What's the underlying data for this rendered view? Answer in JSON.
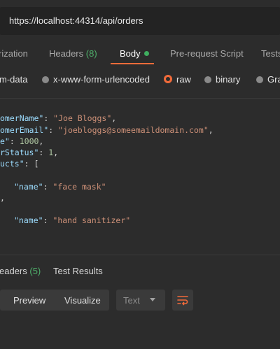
{
  "url": "https://localhost:44314/api/orders",
  "request_tabs": [
    {
      "label": "rization"
    },
    {
      "label": "Headers",
      "count": "(8)"
    },
    {
      "label": "Body"
    },
    {
      "label": "Pre-request Script"
    },
    {
      "label": "Tests"
    }
  ],
  "body_types": [
    {
      "label": "m-data",
      "selected": false
    },
    {
      "label": "x-www-form-urlencoded",
      "selected": false
    },
    {
      "label": "raw",
      "selected": true
    },
    {
      "label": "binary",
      "selected": false
    },
    {
      "label": "Gra",
      "selected": false
    }
  ],
  "editor": {
    "l1_key": "omerName\"",
    "l1_val": "\"Joe Bloggs\"",
    "l2_key": "omerEmail\"",
    "l2_val": "\"joebloggs@someemaildomain.com\"",
    "l3_key": "e\"",
    "l3_val": "1000",
    "l4_key": "rStatus\"",
    "l4_val": "1",
    "l5_key": "ucts\"",
    "l6_key": "\"name\"",
    "l6_val": "\"face mask\"",
    "l7_text": ",",
    "l8_key": "\"name\"",
    "l8_val": "\"hand sanitizer\""
  },
  "response_tabs": {
    "headers": "eaders",
    "headers_count": "(5)",
    "tests": "Test Results"
  },
  "response_toolbar": {
    "preview": "Preview",
    "visualize": "Visualize",
    "format": "Text"
  },
  "colors": {
    "accent": "#f26b3a",
    "count": "#4fb06b"
  }
}
